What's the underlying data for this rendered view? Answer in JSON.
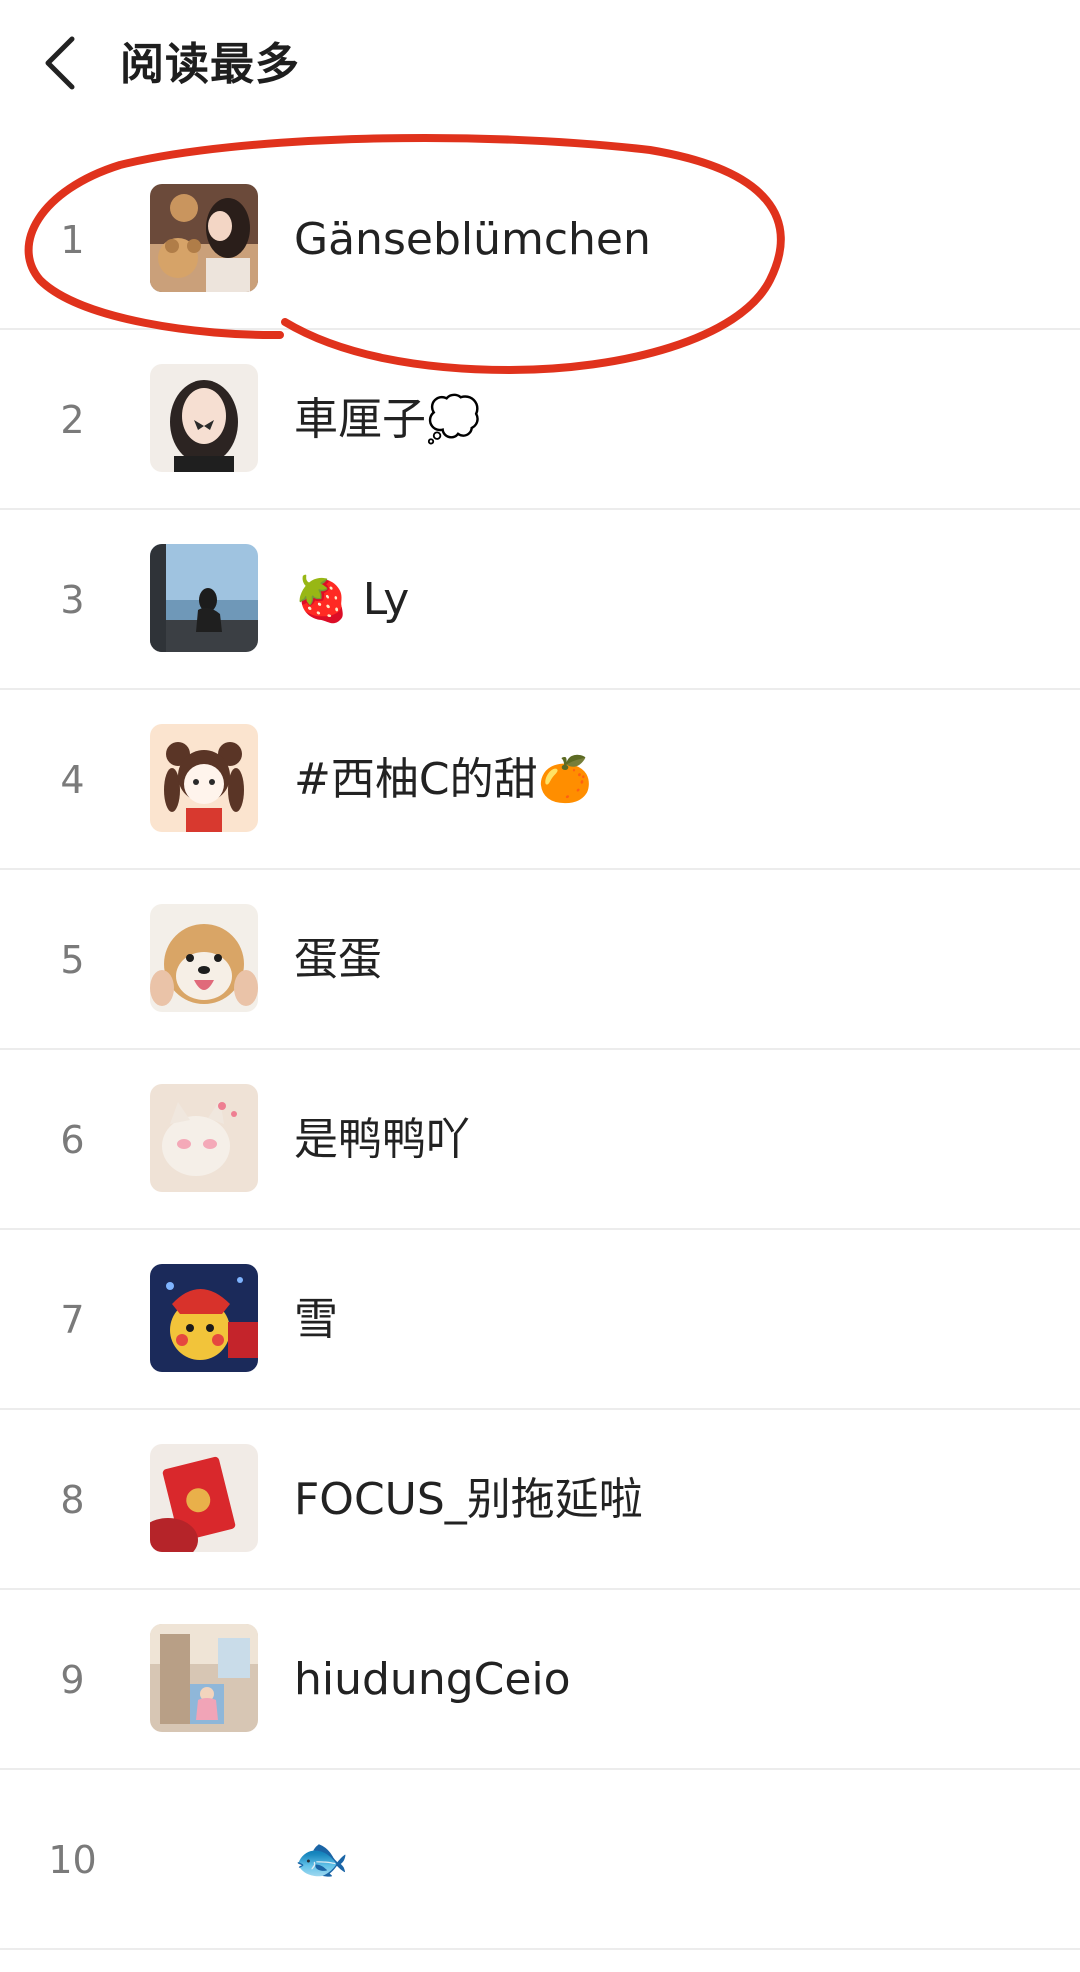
{
  "header": {
    "title": "阅读最多",
    "back_icon": "chevron-left-icon"
  },
  "colors": {
    "annotation_stroke": "#e0321c",
    "divider": "#ececec",
    "rank_text": "#7a7a7a"
  },
  "list": {
    "items": [
      {
        "rank": "1",
        "name": "Gänseblümchen"
      },
      {
        "rank": "2",
        "name": "車厘子💭"
      },
      {
        "rank": "3",
        "name": "🍓 Ly"
      },
      {
        "rank": "4",
        "name": "#西柚C的甜🍊"
      },
      {
        "rank": "5",
        "name": "蛋蛋"
      },
      {
        "rank": "6",
        "name": "是鸭鸭吖"
      },
      {
        "rank": "7",
        "name": "雪"
      },
      {
        "rank": "8",
        "name": "FOCUS_别拖延啦"
      },
      {
        "rank": "9",
        "name": "hiudungCeio"
      },
      {
        "rank": "10",
        "name": "🐟"
      }
    ]
  }
}
